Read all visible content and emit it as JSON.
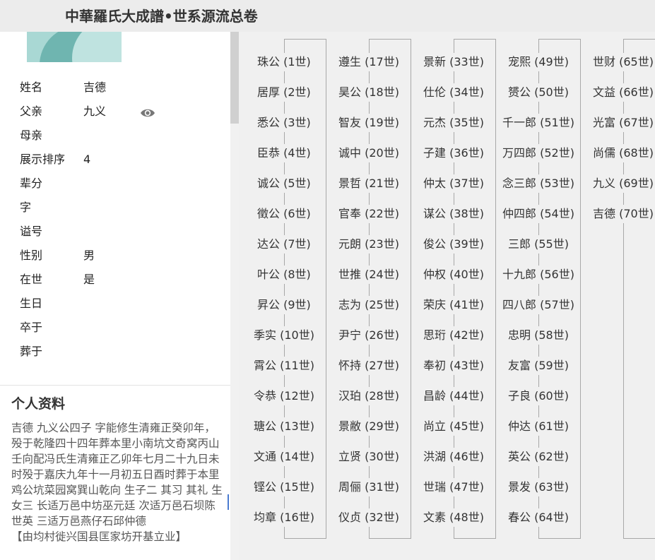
{
  "header": {
    "title": "中華羅氏大成譜•世系源流总卷"
  },
  "person": {
    "fields": [
      {
        "label": "姓名",
        "value": "吉德"
      },
      {
        "label": "父亲",
        "value": "九义"
      },
      {
        "label": "母亲",
        "value": ""
      },
      {
        "label": "展示排序",
        "value": "4"
      },
      {
        "label": "辈分",
        "value": ""
      },
      {
        "label": "字",
        "value": ""
      },
      {
        "label": "谥号",
        "value": ""
      },
      {
        "label": "性别",
        "value": "男"
      },
      {
        "label": "在世",
        "value": "是"
      },
      {
        "label": "生日",
        "value": ""
      },
      {
        "label": "卒于",
        "value": ""
      },
      {
        "label": "葬于",
        "value": ""
      }
    ],
    "view_icon": "eye-icon"
  },
  "profile": {
    "title": "个人资料",
    "body": "吉德  九义公四子  字能修生清雍正癸卯年，殁于乾隆四十四年葬本里小南坑文奇窝丙山壬向配冯氏生清雍正乙卯年七月二十九日未时殁于嘉庆九年十一月初五日酉时葬于本里鸡公坑菜园窝巽山乾向  生子二  其习  其礼  生女三  长适万邑中坊巫元廷  次适万邑石坝陈世英  三适万邑燕仔石邱仲德",
    "source": "【由均村徙兴国县匡家坊开基立业】"
  },
  "generations": [
    "珠公 (1世)",
    "居厚 (2世)",
    "悉公 (3世)",
    "臣恭 (4世)",
    "诚公 (5世)",
    "徵公 (6世)",
    "达公 (7世)",
    "叶公 (8世)",
    "昇公 (9世)",
    "季实 (10世)",
    "霄公 (11世)",
    "令恭 (12世)",
    "瑭公 (13世)",
    "文通 (14世)",
    "铿公 (15世)",
    "均章 (16世)",
    "遵生 (17世)",
    "昊公 (18世)",
    "智友 (19世)",
    "诚中 (20世)",
    "景哲 (21世)",
    "官奉 (22世)",
    "元朗 (23世)",
    "世推 (24世)",
    "志为 (25世)",
    "尹宁 (26世)",
    "怀持 (27世)",
    "汉珀 (28世)",
    "景敝 (29世)",
    "立贤 (30世)",
    "周俪 (31世)",
    "仪贞 (32世)",
    "景新 (33世)",
    "仕伦 (34世)",
    "元杰 (35世)",
    "子建 (36世)",
    "仲太 (37世)",
    "谋公 (38世)",
    "俊公 (39世)",
    "仲权 (40世)",
    "荣庆 (41世)",
    "思珩 (42世)",
    "奉初 (43世)",
    "昌龄 (44世)",
    "尚立 (45世)",
    "洪湖 (46世)",
    "世瑞 (47世)",
    "文素 (48世)",
    "宠熙 (49世)",
    "赟公 (50世)",
    "千一郎 (51世)",
    "万四郎 (52世)",
    "念三郎 (53世)",
    "仲四郎 (54世)",
    "三郎 (55世)",
    "十九郎 (56世)",
    "四八郎 (57世)",
    "忠明 (58世)",
    "友富 (59世)",
    "子良 (60世)",
    "仲达 (61世)",
    "英公 (62世)",
    "景发 (63世)",
    "春公 (64世)",
    "世财 (65世)",
    "文益 (66世)",
    "光富 (67世)",
    "尚儒 (68世)",
    "九义 (69世)",
    "吉德 (70世)"
  ]
}
